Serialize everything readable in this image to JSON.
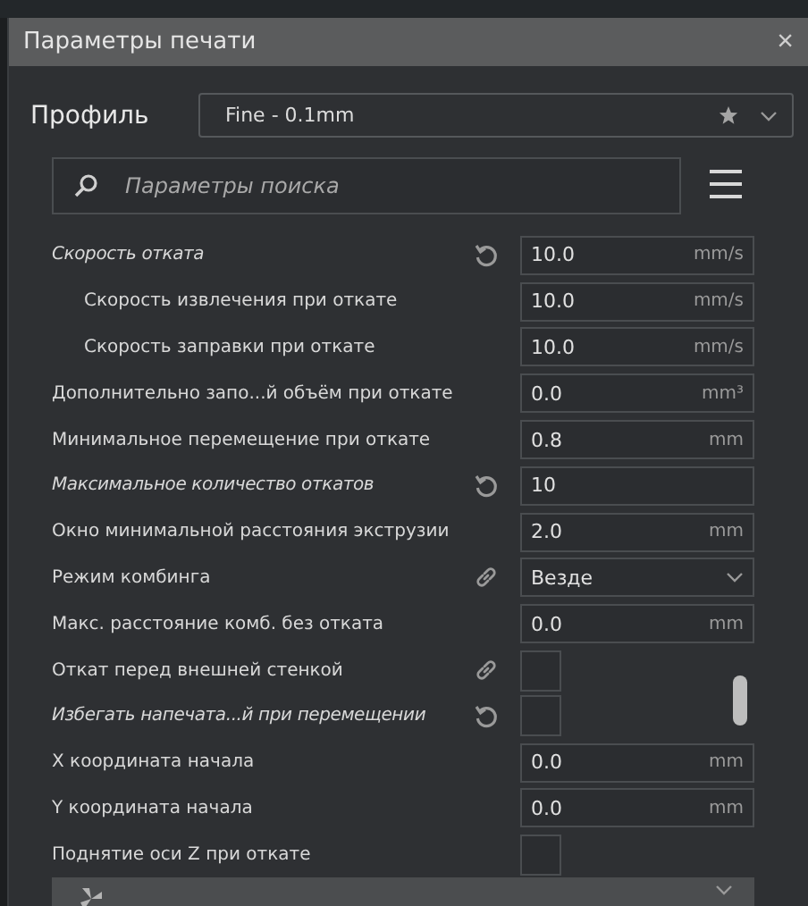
{
  "window": {
    "title": "Параметры печати",
    "close": "×"
  },
  "profile": {
    "label": "Профиль",
    "value": "Fine - 0.1mm"
  },
  "search": {
    "placeholder": "Параметры поиска"
  },
  "settings": [
    {
      "label": "Скорость отката",
      "kind": "number",
      "value": "10.0",
      "unit": "mm/s",
      "modified": true,
      "linked": false,
      "children": [
        {
          "label": "Скорость извлечения при откате",
          "kind": "number",
          "value": "10.0",
          "unit": "mm/s",
          "modified": false,
          "linked": false
        },
        {
          "label": "Скорость заправки при откате",
          "kind": "number",
          "value": "10.0",
          "unit": "mm/s",
          "modified": false,
          "linked": false
        }
      ]
    },
    {
      "label": "Дополнительно запо...й объём при откате",
      "kind": "number",
      "value": "0.0",
      "unit": "mm³",
      "modified": false,
      "linked": false
    },
    {
      "label": "Минимальное перемещение при откате",
      "kind": "number",
      "value": "0.8",
      "unit": "mm",
      "modified": false,
      "linked": false
    },
    {
      "label": "Максимальное количество откатов",
      "kind": "number",
      "value": "10",
      "modified": true,
      "linked": false
    },
    {
      "label": "Окно минимальной расстояния экструзии",
      "kind": "number",
      "value": "2.0",
      "unit": "mm",
      "modified": false,
      "linked": false
    },
    {
      "label": "Режим комбинга",
      "kind": "select",
      "value": "Везде",
      "modified": false,
      "linked": true
    },
    {
      "label": "Макс. расстояние комб. без отката",
      "kind": "number",
      "value": "0.0",
      "unit": "mm",
      "modified": false,
      "linked": false
    },
    {
      "label": "Откат перед внешней стенкой",
      "kind": "checkbox",
      "checked": false,
      "modified": false,
      "linked": true
    },
    {
      "label": "Избегать напечата...й при перемещении",
      "kind": "checkbox",
      "checked": false,
      "modified": true,
      "linked": false
    },
    {
      "label": "X координата начала",
      "kind": "number",
      "value": "0.0",
      "unit": "mm",
      "modified": false,
      "linked": false
    },
    {
      "label": "Y координата начала",
      "kind": "number",
      "value": "0.0",
      "unit": "mm",
      "modified": false,
      "linked": false
    },
    {
      "label": "Поднятие оси Z при откате",
      "kind": "checkbox",
      "checked": false,
      "modified": false,
      "linked": false
    }
  ]
}
